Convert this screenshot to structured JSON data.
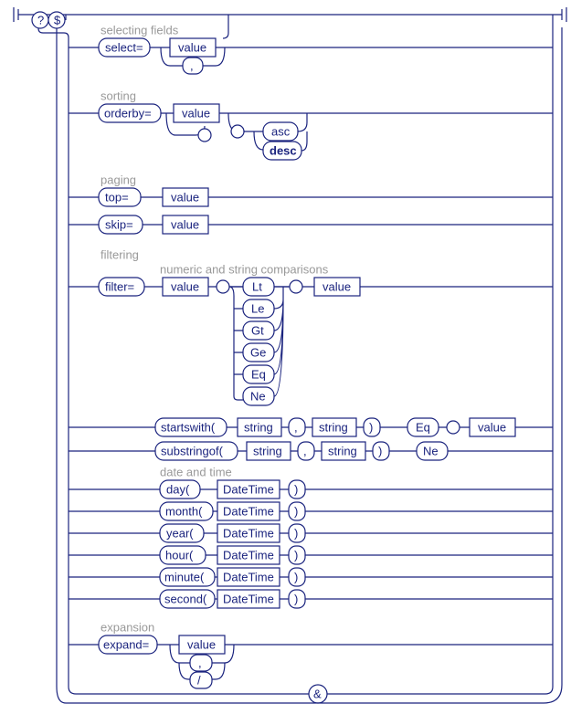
{
  "top": {
    "q": "?",
    "d": "$"
  },
  "sections": {
    "select": {
      "heading": "selecting fields",
      "op": "select=",
      "val": "value",
      "sep": ","
    },
    "sort": {
      "heading": "sorting",
      "op": "orderby=",
      "val": "value",
      "asc": "asc",
      "desc": "desc"
    },
    "paging": {
      "heading": "paging",
      "top": "top=",
      "skip": "skip=",
      "val": "value"
    },
    "filter": {
      "heading": "filtering",
      "sub_numeric": "numeric and string comparisons",
      "op": "filter=",
      "val": "value",
      "cmp": {
        "lt": "Lt",
        "le": "Le",
        "gt": "Gt",
        "ge": "Ge",
        "eq": "Eq",
        "ne": "Ne"
      },
      "sw": "startswith(",
      "so": "substringof(",
      "str": "string",
      "comma": ",",
      "rparen": ")",
      "eq2": "Eq",
      "ne2": "Ne",
      "sub_date": "date and time",
      "fn": {
        "day": "day(",
        "month": "month(",
        "year": "year(",
        "hour": "hour(",
        "minute": "minute(",
        "second": "second("
      },
      "dt": "DateTime"
    },
    "expand": {
      "heading": "expansion",
      "op": "expand=",
      "val": "value",
      "sep1": ",",
      "sep2": "/"
    }
  },
  "join": "&"
}
